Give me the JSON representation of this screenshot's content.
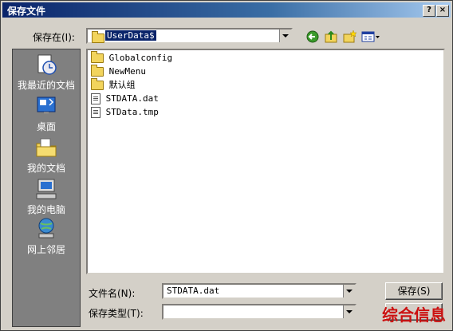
{
  "window": {
    "title": "保存文件",
    "help_label": "?",
    "close_label": "×"
  },
  "savein": {
    "label": "保存在(I):",
    "value": "UserData$"
  },
  "places": [
    {
      "label": "我最近的文档",
      "icon": "recent-documents-icon"
    },
    {
      "label": "桌面",
      "icon": "desktop-icon"
    },
    {
      "label": "我的文档",
      "icon": "my-documents-icon"
    },
    {
      "label": "我的电脑",
      "icon": "my-computer-icon"
    },
    {
      "label": "网上邻居",
      "icon": "network-places-icon"
    }
  ],
  "files": [
    {
      "name": "Globalconfig",
      "type": "folder"
    },
    {
      "name": "NewMenu",
      "type": "folder"
    },
    {
      "name": "默认组",
      "type": "folder"
    },
    {
      "name": "STDATA.dat",
      "type": "file"
    },
    {
      "name": "STData.tmp",
      "type": "file"
    }
  ],
  "filename": {
    "label": "文件名(N):",
    "value": "STDATA.dat"
  },
  "filetype": {
    "label": "保存类型(T):",
    "value": ""
  },
  "buttons": {
    "save": "保存(S)"
  },
  "watermark": "综合信息",
  "colors": {
    "titlebar": "#0a246a",
    "face": "#d4d0c8",
    "places": "#808080",
    "watermark": "#cc1010"
  }
}
